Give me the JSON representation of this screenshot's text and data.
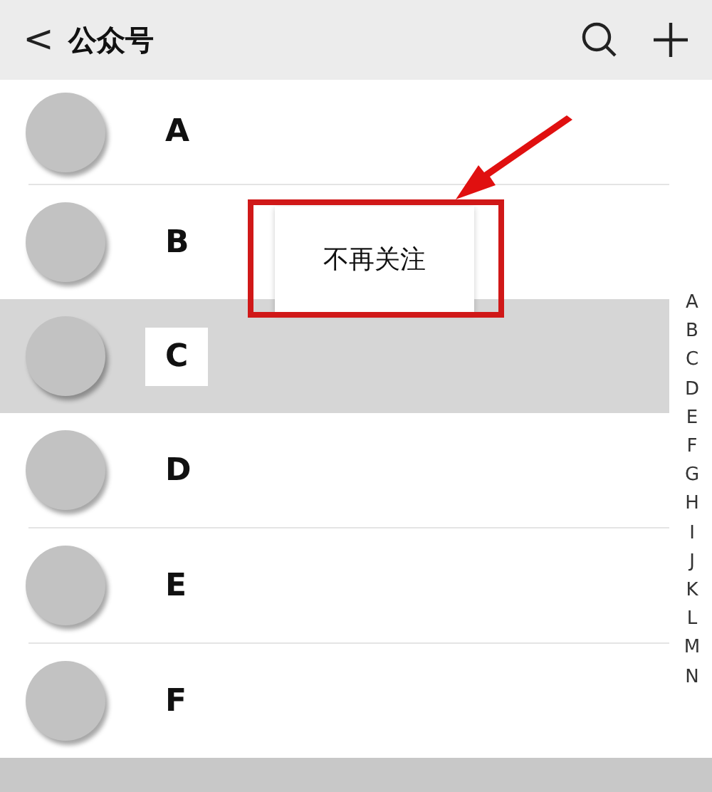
{
  "header": {
    "back": "<",
    "title": "公众号"
  },
  "accounts": [
    {
      "name": "A",
      "selected": false
    },
    {
      "name": "B",
      "selected": false
    },
    {
      "name": "C",
      "selected": true
    },
    {
      "name": "D",
      "selected": false
    },
    {
      "name": "E",
      "selected": false
    },
    {
      "name": "F",
      "selected": false
    }
  ],
  "context_menu": {
    "items": [
      "不再关注"
    ]
  },
  "index_bar": [
    "A",
    "B",
    "C",
    "D",
    "E",
    "F",
    "G",
    "H",
    "I",
    "J",
    "K",
    "L",
    "M",
    "N"
  ]
}
